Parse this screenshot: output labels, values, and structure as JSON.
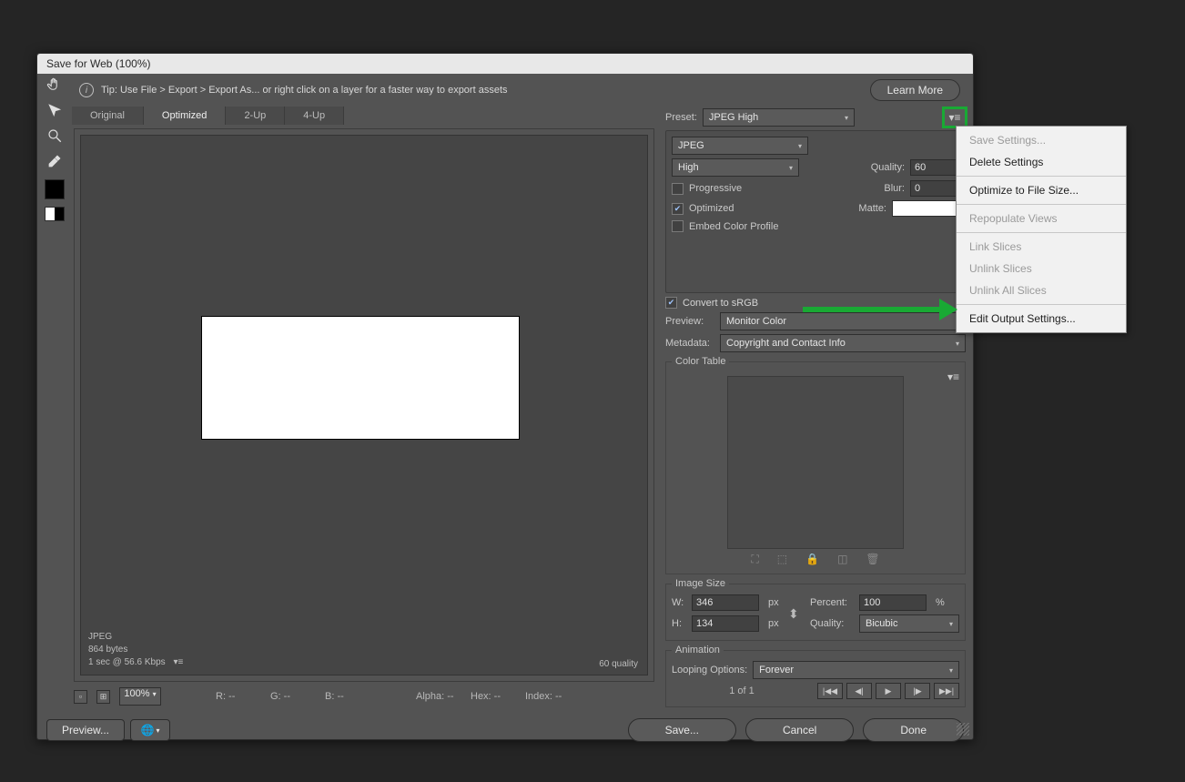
{
  "dialog": {
    "title": "Save for Web (100%)",
    "tip": "Tip: Use File > Export > Export As...  or right click on a layer for a faster way to export assets",
    "learn_more": "Learn More"
  },
  "tabs": {
    "original": "Original",
    "optimized": "Optimized",
    "two_up": "2-Up",
    "four_up": "4-Up"
  },
  "preview_info": {
    "format": "JPEG",
    "size": "864 bytes",
    "time": "1 sec @ 56.6 Kbps",
    "quality": "60 quality"
  },
  "status": {
    "zoom": "100%",
    "r": "R: --",
    "g": "G: --",
    "b": "B: --",
    "alpha": "Alpha: --",
    "hex": "Hex: --",
    "index": "Index: --"
  },
  "preset": {
    "label": "Preset:",
    "value": "JPEG High"
  },
  "format_select": "JPEG",
  "quality_preset": "High",
  "options": {
    "progressive": "Progressive",
    "optimized": "Optimized",
    "embed_profile": "Embed Color Profile",
    "quality_label": "Quality:",
    "quality_value": "60",
    "blur_label": "Blur:",
    "blur_value": "0",
    "matte_label": "Matte:"
  },
  "convert_srgb": "Convert to sRGB",
  "preview_label": "Preview:",
  "preview_value": "Monitor Color",
  "metadata_label": "Metadata:",
  "metadata_value": "Copyright and Contact Info",
  "color_table": {
    "title": "Color Table"
  },
  "image_size": {
    "title": "Image Size",
    "w_label": "W:",
    "w_value": "346",
    "h_label": "H:",
    "h_value": "134",
    "px": "px",
    "percent_label": "Percent:",
    "percent_value": "100",
    "pct": "%",
    "quality_label": "Quality:",
    "quality_value": "Bicubic"
  },
  "animation": {
    "title": "Animation",
    "loop_label": "Looping Options:",
    "loop_value": "Forever",
    "page": "1 of 1"
  },
  "footer": {
    "preview": "Preview...",
    "save": "Save...",
    "cancel": "Cancel",
    "done": "Done"
  },
  "menu": {
    "save_settings": "Save Settings...",
    "delete_settings": "Delete Settings",
    "optimize_to_size": "Optimize to File Size...",
    "repopulate": "Repopulate Views",
    "link_slices": "Link Slices",
    "unlink_slices": "Unlink Slices",
    "unlink_all": "Unlink All Slices",
    "edit_output": "Edit Output Settings..."
  }
}
